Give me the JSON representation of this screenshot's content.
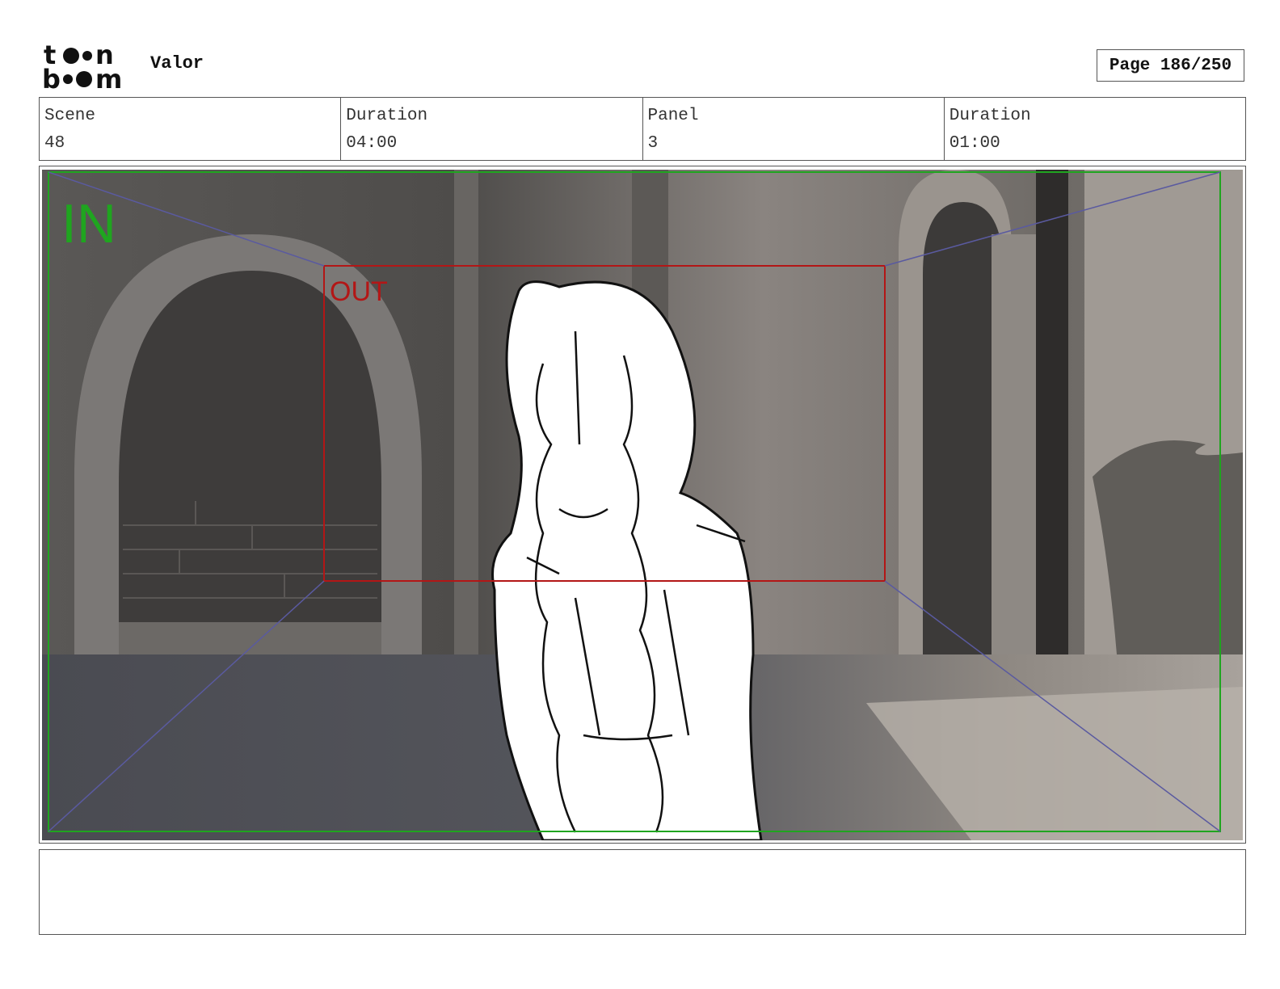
{
  "header": {
    "logo_top": "t••n",
    "logo_bottom": "b••m",
    "project_title": "Valor",
    "page_label": "Page 186/250"
  },
  "info": {
    "scene_label": "Scene",
    "scene_value": "48",
    "scene_duration_label": "Duration",
    "scene_duration_value": "04:00",
    "panel_label": "Panel",
    "panel_value": "3",
    "panel_duration_label": "Duration",
    "panel_duration_value": "01:00"
  },
  "panel": {
    "in_label": "IN",
    "out_label": "OUT",
    "in_color": "#1fa51f",
    "out_color": "#b31616",
    "guide_color": "#5a5aa0"
  },
  "notes": {
    "text": ""
  }
}
